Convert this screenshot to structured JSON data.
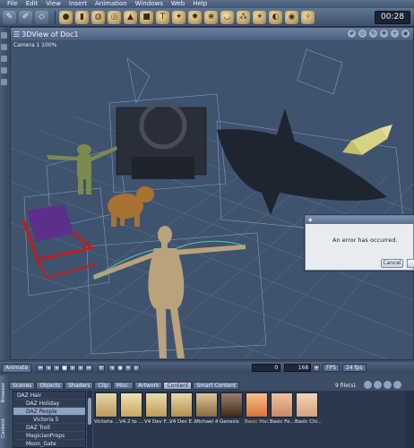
{
  "menu": [
    "File",
    "Edit",
    "View",
    "Insert",
    "Animation",
    "Windows",
    "Web",
    "Help"
  ],
  "timer": "00:28",
  "viewport": {
    "title": "3DView of Doc1",
    "camera_label": "Camera 1  100%"
  },
  "error_dialog": {
    "message": "An error has occurred.",
    "cancel_label": "Cancel"
  },
  "animbar": {
    "animate_label": "Animate",
    "frame_current": "0",
    "frame_total": "168",
    "fps_label": "FPS",
    "fps_value": "24 fps"
  },
  "content_panel": {
    "tabs": [
      "Scenes",
      "Objects",
      "Shaders",
      "Clip",
      "Misc.",
      "Artwork",
      "Content",
      "Smart Content"
    ],
    "active_tab": "Content",
    "file_count": "9 file(s).",
    "side_tab_labels": [
      "Browser",
      "Content"
    ],
    "tree": [
      {
        "label": "DAZ Hair",
        "level": 1
      },
      {
        "label": "DAZ Holiday",
        "level": 1
      },
      {
        "label": "DAZ People",
        "level": 1,
        "selected": true
      },
      {
        "label": "Victoria 5",
        "level": 2
      },
      {
        "label": "DAZ Troll",
        "level": 1
      },
      {
        "label": "MagicianProps",
        "level": 1
      },
      {
        "label": "Moon_Gate",
        "level": 1
      }
    ],
    "thumbnails": [
      "Victoria ...",
      "V4.2 to ...",
      "V4 Dev F...",
      "V4 Dev E...",
      "Michael 4",
      "Genesis",
      "Basic Mal...",
      "Basic Fe...",
      "Basic Chi..."
    ]
  },
  "colors": {
    "background": "#3b4c63",
    "viewport_bg": "#3f536f",
    "dialog_bg": "#e8ebf0",
    "selected_tree_item": "#8ea3c2"
  }
}
